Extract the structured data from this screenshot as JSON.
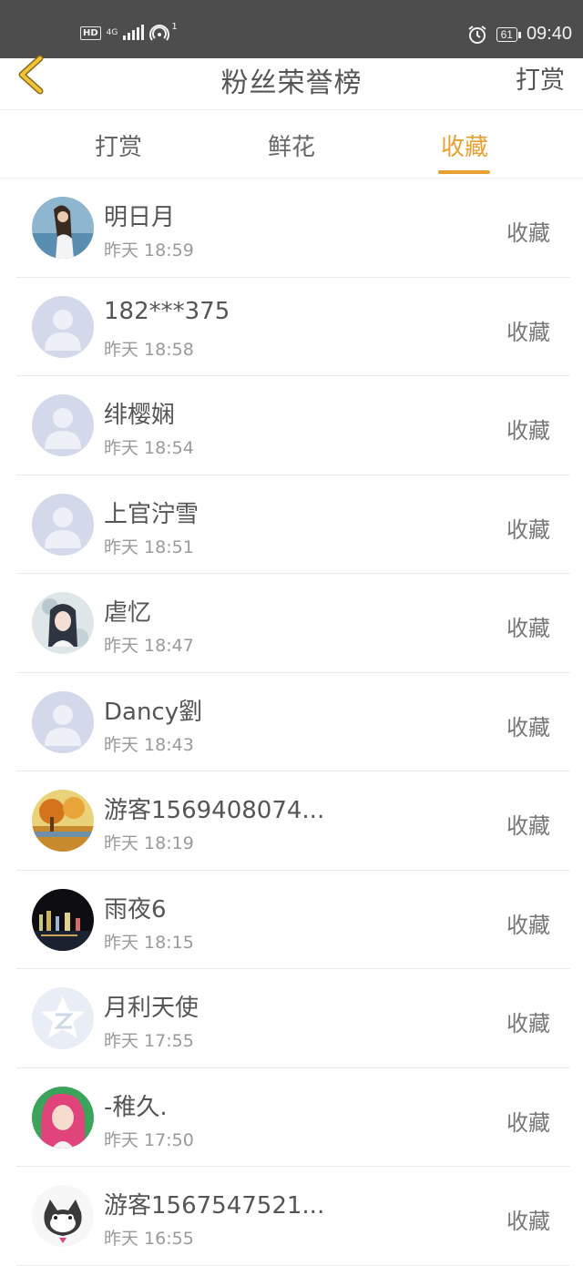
{
  "status_bar": {
    "hd": "HD",
    "network": "4G",
    "hotspot_count": "1",
    "battery": "61",
    "time": "09:40"
  },
  "header": {
    "title": "粉丝荣誉榜",
    "right_action": "打赏"
  },
  "tabs": [
    {
      "label": "打赏",
      "active": false
    },
    {
      "label": "鲜花",
      "active": false
    },
    {
      "label": "收藏",
      "active": true
    }
  ],
  "colors": {
    "accent": "#e8a12f",
    "avatar_default": "#d3d8ea"
  },
  "rows": [
    {
      "name": "明日月",
      "time": "昨天 18:59",
      "action": "收藏",
      "avatar": "photo-girl"
    },
    {
      "name": "182***375",
      "time": "昨天 18:58",
      "action": "收藏",
      "avatar": "default"
    },
    {
      "name": "绯樱娴",
      "time": "昨天 18:54",
      "action": "收藏",
      "avatar": "default"
    },
    {
      "name": "上官泞雪",
      "time": "昨天 18:51",
      "action": "收藏",
      "avatar": "default"
    },
    {
      "name": "虐忆",
      "time": "昨天 18:47",
      "action": "收藏",
      "avatar": "photo-anime"
    },
    {
      "name": "Dancy劉",
      "time": "昨天 18:43",
      "action": "收藏",
      "avatar": "default"
    },
    {
      "name": "游客1569408074...",
      "time": "昨天 18:19",
      "action": "收藏",
      "avatar": "photo-autumn"
    },
    {
      "name": "雨夜6",
      "time": "昨天 18:15",
      "action": "收藏",
      "avatar": "photo-night"
    },
    {
      "name": "月利天使",
      "time": "昨天 17:55",
      "action": "收藏",
      "avatar": "qzone"
    },
    {
      "name": "-稚久.",
      "time": "昨天 17:50",
      "action": "收藏",
      "avatar": "photo-pink"
    },
    {
      "name": "游客1567547521...",
      "time": "昨天 16:55",
      "action": "收藏",
      "avatar": "photo-cat"
    }
  ]
}
